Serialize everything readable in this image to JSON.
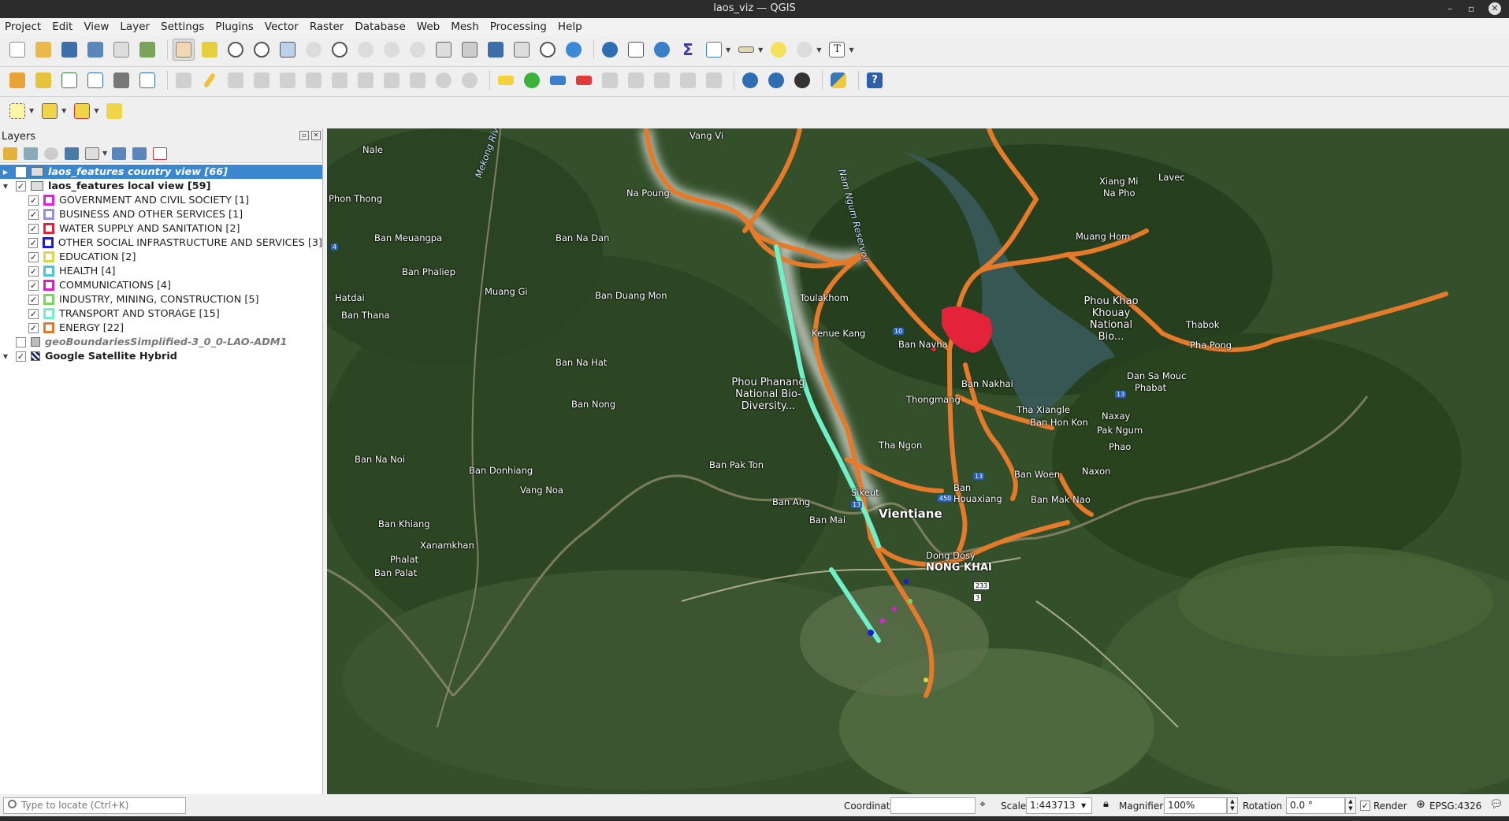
{
  "window": {
    "title": "laos_viz — QGIS"
  },
  "menu": [
    "Project",
    "Edit",
    "View",
    "Layer",
    "Settings",
    "Plugins",
    "Vector",
    "Raster",
    "Database",
    "Web",
    "Mesh",
    "Processing",
    "Help"
  ],
  "layers_panel": {
    "title": "Layers",
    "layers": [
      {
        "label": "laos_features country view [66]",
        "checked": false,
        "selected": true
      },
      {
        "label": "laos_features local view [59]",
        "checked": true
      },
      {
        "label": "geoBoundariesSimplified-3_0_0-LAO-ADM1",
        "checked": false
      },
      {
        "label": "Google Satellite Hybrid",
        "checked": true
      }
    ],
    "categories": [
      {
        "label": "GOVERNMENT AND CIVIL SOCIETY [1]",
        "color": "#e81ee8"
      },
      {
        "label": "BUSINESS AND OTHER SERVICES [1]",
        "color": "#9b8ce0"
      },
      {
        "label": "WATER SUPPLY AND SANITATION [2]",
        "color": "#e3233a"
      },
      {
        "label": "OTHER SOCIAL INFRASTRUCTURE AND SERVICES [3]",
        "color": "#1b1bd6"
      },
      {
        "label": "EDUCATION [2]",
        "color": "#d8d84a"
      },
      {
        "label": "HEALTH [4]",
        "color": "#46c6d8"
      },
      {
        "label": "COMMUNICATIONS [4]",
        "color": "#d81ec6"
      },
      {
        "label": "INDUSTRY, MINING, CONSTRUCTION [5]",
        "color": "#7ad65a"
      },
      {
        "label": "TRANSPORT AND STORAGE [15]",
        "color": "#6ff0c8"
      },
      {
        "label": "ENERGY [22]",
        "color": "#e57a2a"
      }
    ]
  },
  "map": {
    "labels": [
      {
        "t": "Vang Vi",
        "c": "tl"
      },
      {
        "t": "Nale",
        "c": "tl"
      },
      {
        "t": "Mekong River",
        "c": "w"
      },
      {
        "t": "Phon Thong",
        "c": "tl"
      },
      {
        "t": "Ban Meuangpa",
        "c": "tl"
      },
      {
        "t": "Ban Phaliep",
        "c": "tl"
      },
      {
        "t": "Muang Gi",
        "c": "tl"
      },
      {
        "t": "Hatdai",
        "c": "tl"
      },
      {
        "t": "Ban Thana",
        "c": "tl"
      },
      {
        "t": "Ban Na Dan",
        "c": "tl"
      },
      {
        "t": "Ban Duang Mon",
        "c": "tl"
      },
      {
        "t": "Ban Na Hat",
        "c": "tl"
      },
      {
        "t": "Ban Nong",
        "c": "tl"
      },
      {
        "t": "Ban Na Noi",
        "c": "tl"
      },
      {
        "t": "Ban Donhiang",
        "c": "tl"
      },
      {
        "t": "Vang Noa",
        "c": "tl"
      },
      {
        "t": "Ban Khiang",
        "c": "tl"
      },
      {
        "t": "Phalat",
        "c": "tl"
      },
      {
        "t": "Ban Palat",
        "c": "tl"
      },
      {
        "t": "Xanamkhan",
        "c": "tl"
      },
      {
        "t": "Na Poung",
        "c": "tl"
      },
      {
        "t": "Nam Ngum Reservoir",
        "c": "w"
      },
      {
        "t": "Xiang Mi",
        "c": "tl"
      },
      {
        "t": "Lavec",
        "c": "tl"
      },
      {
        "t": "Na Pho",
        "c": "tl"
      },
      {
        "t": "Muang Hom",
        "c": "tl"
      },
      {
        "t": "Phou Khao Khouay National Bio...",
        "c": "tl"
      },
      {
        "t": "Thabok",
        "c": "tl"
      },
      {
        "t": "Pha Pong",
        "c": "tl"
      },
      {
        "t": "Toulakhom",
        "c": "tl"
      },
      {
        "t": "Kenue Kang",
        "c": "tl"
      },
      {
        "t": "Ban Navha",
        "c": "tl"
      },
      {
        "t": "Phou Phanang National Bio-Diversity...",
        "c": "tl"
      },
      {
        "t": "Ban Nakhai",
        "c": "tl"
      },
      {
        "t": "Tha Xiangle",
        "c": "tl"
      },
      {
        "t": "Dan Sa Mouc",
        "c": "tl"
      },
      {
        "t": "Phabat",
        "c": "tl"
      },
      {
        "t": "Naxay",
        "c": "tl"
      },
      {
        "t": "Ban Hon Kon",
        "c": "tl"
      },
      {
        "t": "Pak Ngum",
        "c": "tl"
      },
      {
        "t": "Phao",
        "c": "tl"
      },
      {
        "t": "Ban Woen",
        "c": "tl"
      },
      {
        "t": "Naxon",
        "c": "tl"
      },
      {
        "t": "Ban Mak Nao",
        "c": "tl"
      },
      {
        "t": "Ban Pak Ton",
        "c": "tl"
      },
      {
        "t": "Ban Ang",
        "c": "tl"
      },
      {
        "t": "Ban Mai",
        "c": "tl"
      },
      {
        "t": "Sikeut",
        "c": "tl"
      },
      {
        "t": "Vientiane",
        "c": "big"
      },
      {
        "t": "NONG KHAI",
        "c": "big"
      },
      {
        "t": "Ban Houaxiang",
        "c": "tl"
      },
      {
        "t": "Thongmang",
        "c": "tl"
      },
      {
        "t": "Tha Ngon",
        "c": "tl"
      },
      {
        "t": "Dong Dosy",
        "c": "tl"
      }
    ]
  },
  "statusbar": {
    "locator_placeholder": "Type to locate (Ctrl+K)",
    "coordinate_label": "Coordinate",
    "coordinate_value": "",
    "scale_label": "Scale",
    "scale_value": "1:443713",
    "magnifier_label": "Magnifier",
    "magnifier_value": "100%",
    "rotation_label": "Rotation",
    "rotation_value": "0.0 °",
    "render_label": "Render",
    "render_checked": true,
    "crs": "EPSG:4326"
  }
}
